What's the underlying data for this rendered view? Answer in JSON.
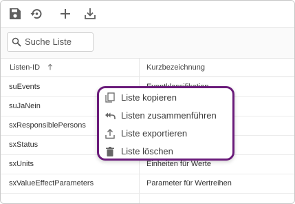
{
  "toolbar": {
    "buttons": [
      {
        "icon": "save-icon"
      },
      {
        "icon": "restore-icon"
      },
      {
        "icon": "add-icon"
      },
      {
        "icon": "import-icon"
      }
    ]
  },
  "search": {
    "placeholder": "Suche Liste",
    "value": ""
  },
  "table": {
    "columns": [
      {
        "label": "Listen-ID",
        "sort": "ascending"
      },
      {
        "label": "Kurzbezeichnung"
      }
    ],
    "rows": [
      {
        "id": "suEvents",
        "desc": "Eventklassifikation"
      },
      {
        "id": "suJaNein",
        "desc": ""
      },
      {
        "id": "sxResponsiblePersons",
        "desc": ""
      },
      {
        "id": "sxStatus",
        "desc": ""
      },
      {
        "id": "sxUnits",
        "desc": "Einheiten für Werte"
      },
      {
        "id": "sxValueEffectParameters",
        "desc": "Parameter für Wertreihen"
      }
    ]
  },
  "context_menu": {
    "border_color": "#6a1b7a",
    "items": [
      {
        "label": "Liste kopieren",
        "icon": "copy-icon"
      },
      {
        "label": "Listen zusammenführen",
        "icon": "merge-icon"
      },
      {
        "label": "Liste exportieren",
        "icon": "export-icon"
      },
      {
        "label": "Liste löschen",
        "icon": "trash-icon"
      }
    ]
  }
}
